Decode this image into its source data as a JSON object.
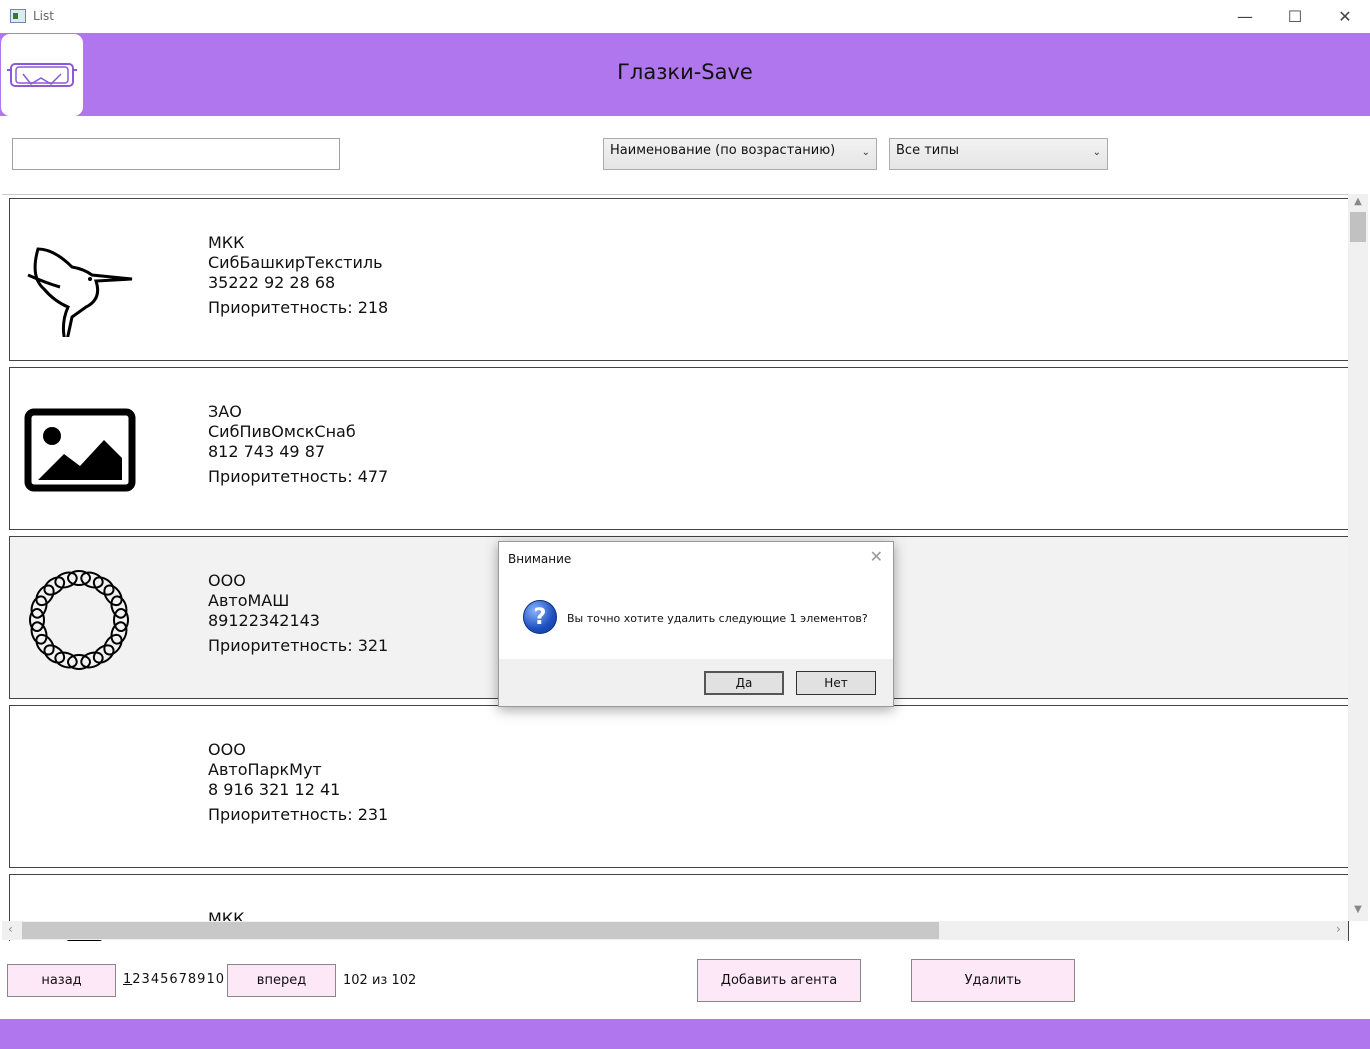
{
  "window": {
    "title": "List",
    "minimize": "—",
    "maximize": "☐",
    "close": "✕"
  },
  "header": {
    "title": "Глазки-Save"
  },
  "filters": {
    "search_value": "",
    "sort_selected": "Наименование (по возрастанию)",
    "type_selected": "Все типы"
  },
  "agents": [
    {
      "type": "МКК",
      "name": "СибБашкирТекстиль",
      "phone": "35222 92 28 68",
      "priority": "Приоритетность: 218",
      "icon": "hummingbird-icon"
    },
    {
      "type": "ЗАО",
      "name": "СибПивОмскСнаб",
      "phone": "812 743 49 87",
      "priority": "Приоритетность: 477",
      "icon": "image-placeholder-icon"
    },
    {
      "type": "ООО",
      "name": "АвтоМАШ",
      "phone": "89122342143",
      "priority": "Приоритетность: 321",
      "icon": "circle-loops-icon"
    },
    {
      "type": "ООО",
      "name": "АвтоПаркМут",
      "phone": "8 916 321 12 41",
      "priority": "Приоритетность: 231",
      "icon": ""
    },
    {
      "type": "МКК",
      "name": "",
      "phone": "",
      "priority": "",
      "icon": "partial-logo-icon"
    }
  ],
  "pagination": {
    "back_label": "назад",
    "pages_first": "1",
    "pages_rest": "2345678910",
    "forward_label": "вперед",
    "count_text": "102 из 102"
  },
  "actions": {
    "add_label": "Добавить агента",
    "delete_label": "Удалить"
  },
  "dialog": {
    "title": "Внимание",
    "message": "Вы точно хотите удалить следующие 1 элементов?",
    "yes_label": "Да",
    "no_label": "Нет",
    "icon": "question-icon"
  },
  "colors": {
    "accent": "#b076ee",
    "button_bg": "#fde8f8"
  }
}
